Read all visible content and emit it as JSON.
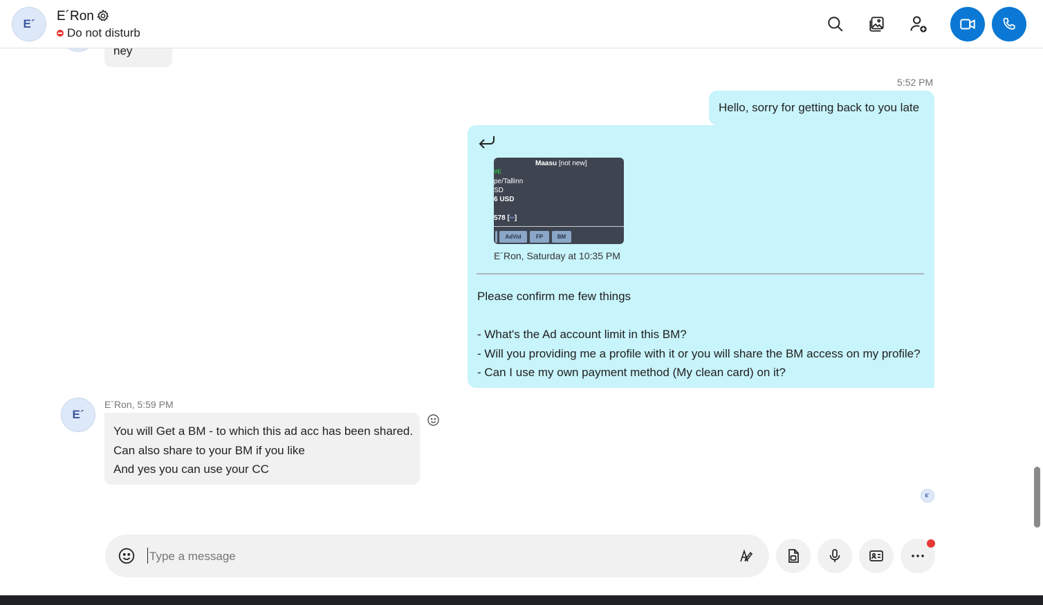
{
  "header": {
    "avatar_initials": "E´",
    "contact_name": "E´Ron",
    "status": "Do not disturb",
    "status_color": "#e53935",
    "actions": [
      {
        "name": "search-icon"
      },
      {
        "name": "gallery-icon"
      },
      {
        "name": "add-person-icon"
      },
      {
        "name": "video-call-icon"
      },
      {
        "name": "audio-call-icon"
      }
    ]
  },
  "messages": {
    "prev_incoming_text": "hey",
    "outgoing_time": "5:52 PM",
    "outgoing_text": "Hello, sorry for getting back to you late",
    "quote": {
      "icon": "reply-arrow-icon",
      "thumb_title": "Maasu",
      "thumb_title_note": "[not new]",
      "thumb_lines": [
        "VE",
        "pe/Tallinn",
        "SD",
        "6 USD",
        "578 ["
      ],
      "thumb_buttons": [
        "AdVid",
        "FP",
        "BM"
      ],
      "caption": "E´Ron, Saturday at 10:35 PM"
    },
    "reply_lines": [
      "Please confirm me few things",
      "- What's the Ad account limit in this BM?",
      "- Will you providing me a profile with it or you will share the BM access on my profile?",
      "- Can I use my own payment method (My clean card) on it?"
    ],
    "incoming": {
      "avatar_initials": "E´",
      "sender_time": "E´Ron, 5:59 PM",
      "lines": [
        "You will Get a BM - to which this ad acc has been shared.",
        "Can also share to your BM if you like",
        "And yes you can use your CC"
      ]
    },
    "read_receipt_initials": "E´"
  },
  "composer": {
    "placeholder": "Type a message"
  },
  "colors": {
    "accent": "#0a78d4",
    "outgoing_bubble": "#c8f4fb",
    "incoming_bubble": "#f1f1f1"
  }
}
